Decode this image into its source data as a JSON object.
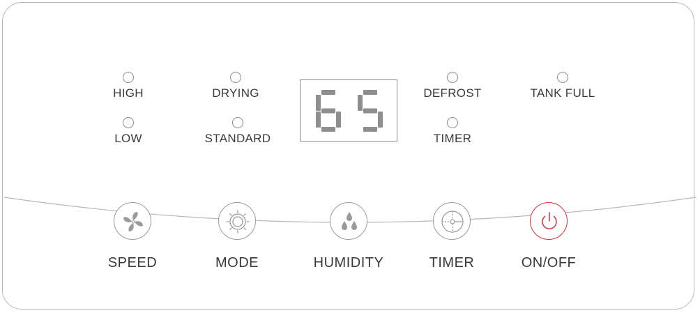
{
  "indicators": {
    "high": "HIGH",
    "low": "LOW",
    "drying": "DRYING",
    "standard": "STANDARD",
    "defrost": "DEFROST",
    "timer": "TIMER",
    "tank_full": "TANK FULL"
  },
  "display": {
    "value": "65"
  },
  "buttons": {
    "speed": "SPEED",
    "mode": "MODE",
    "humidity": "HUMIDITY",
    "timer": "TIMER",
    "on_off": "ON/OFF"
  },
  "colors": {
    "outline": "#b8b8b8",
    "text": "#3a3a3a",
    "icon": "#9a9a9a",
    "power_accent": "#d8303a"
  },
  "icons": {
    "speed": "fan-icon",
    "mode": "gear-icon",
    "humidity": "droplets-icon",
    "timer": "timer-icon",
    "on_off": "power-icon"
  }
}
